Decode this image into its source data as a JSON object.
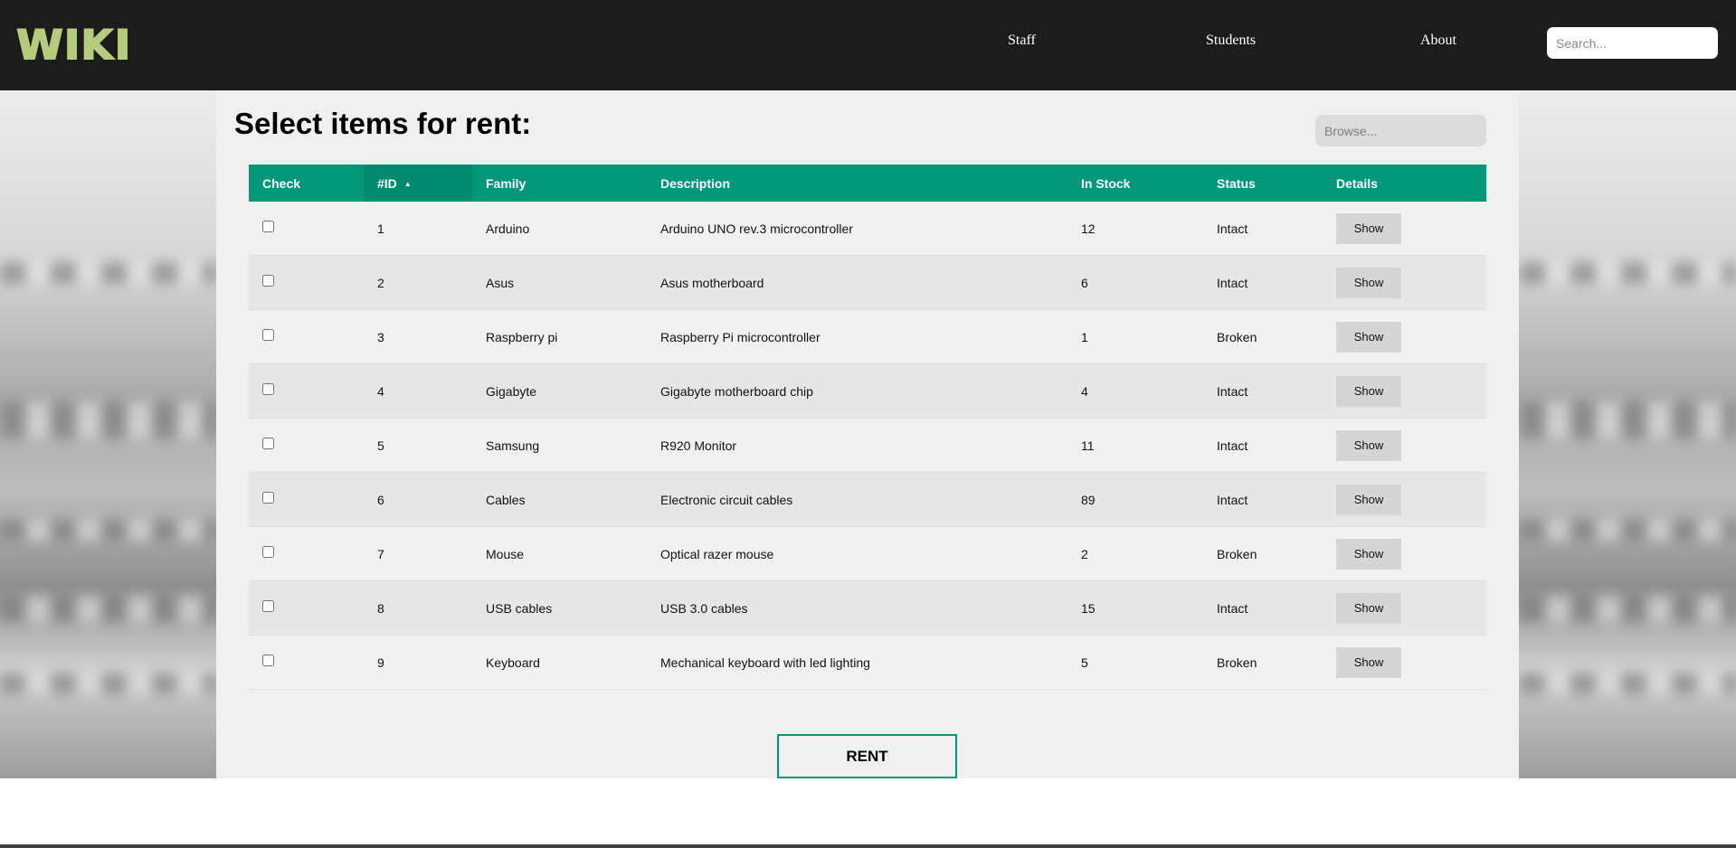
{
  "nav": {
    "logo": "WIKI",
    "links": [
      "Staff",
      "Students",
      "About"
    ],
    "search_placeholder": "Search..."
  },
  "main": {
    "title": "Select items for rent:",
    "browse_placeholder": "Browse...",
    "columns": [
      "Check",
      "#ID",
      "Family",
      "Description",
      "In Stock",
      "Status",
      "Details"
    ],
    "sorted_column": "#ID",
    "sort_direction": "ascending",
    "rows": [
      {
        "id": "1",
        "family": "Arduino",
        "description": "Arduino UNO rev.3 microcontroller",
        "stock": "12",
        "status": "Intact",
        "checked": false,
        "details_label": "Show"
      },
      {
        "id": "2",
        "family": "Asus",
        "description": "Asus motherboard",
        "stock": "6",
        "status": "Intact",
        "checked": false,
        "details_label": "Show"
      },
      {
        "id": "3",
        "family": "Raspberry pi",
        "description": "Raspberry Pi microcontroller",
        "stock": "1",
        "status": "Broken",
        "checked": false,
        "details_label": "Show"
      },
      {
        "id": "4",
        "family": "Gigabyte",
        "description": "Gigabyte motherboard chip",
        "stock": "4",
        "status": "Intact",
        "checked": false,
        "details_label": "Show"
      },
      {
        "id": "5",
        "family": "Samsung",
        "description": "R920 Monitor",
        "stock": "11",
        "status": "Intact",
        "checked": false,
        "details_label": "Show"
      },
      {
        "id": "6",
        "family": "Cables",
        "description": "Electronic circuit cables",
        "stock": "89",
        "status": "Intact",
        "checked": false,
        "details_label": "Show"
      },
      {
        "id": "7",
        "family": "Mouse",
        "description": "Optical razer mouse",
        "stock": "2",
        "status": "Broken",
        "checked": false,
        "details_label": "Show"
      },
      {
        "id": "8",
        "family": "USB cables",
        "description": "USB 3.0 cables",
        "stock": "15",
        "status": "Intact",
        "checked": false,
        "details_label": "Show"
      },
      {
        "id": "9",
        "family": "Keyboard",
        "description": "Mechanical keyboard with led lighting",
        "stock": "5",
        "status": "Broken",
        "checked": false,
        "details_label": "Show"
      }
    ],
    "rent_label": "RENT"
  },
  "colors": {
    "navbar": "#1c1c1c",
    "logo": "#b5cc7e",
    "table_header": "#009879",
    "panel": "#f0f0f0"
  },
  "icons": {
    "sort": "caret-up-icon"
  }
}
